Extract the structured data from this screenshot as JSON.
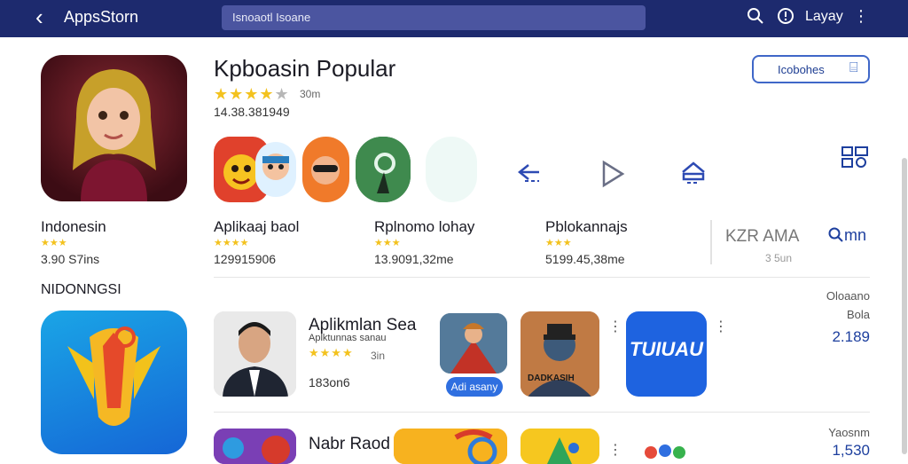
{
  "header": {
    "title": "AppsStorn",
    "search_placeholder": "Isnoaotl Isoane",
    "right_label": "Layay"
  },
  "hero": {
    "title": "Kpboasin Popular",
    "stars": "★★★★",
    "stars_off": "★",
    "rating_text": "30m",
    "downloads": "14.38.381949",
    "install_label": "Icobohes"
  },
  "categories": [
    {
      "name": "Indonesin",
      "stars": "★★★",
      "count": "3.90 S7ins"
    },
    {
      "name": "Aplikaaj baol",
      "stars": "★★★★",
      "count": "129915906"
    },
    {
      "name": "Rplnomo lohay",
      "stars": "★★★",
      "count": "13.9091,32me"
    },
    {
      "name": "Pblokannajs",
      "stars": "★★★",
      "count": "5199.45,38me"
    }
  ],
  "extra": {
    "kzr": "KZR AMA",
    "kzr_sub": "3 5un",
    "more": "mn"
  },
  "section": {
    "title": "NIDONNGSI"
  },
  "featured": {
    "title": "Aplikmlan Sea",
    "subtitle": "Aplktunnas sanau",
    "stars": "★★★★",
    "rating_text": "3in",
    "count": "183on6",
    "pill_label": "Adi asany",
    "tile_label": "TUIUAU",
    "poster_text": "DADKASIH"
  },
  "right_column": [
    {
      "label": "Oloaano",
      "sub": "Bola",
      "value": "2.189"
    },
    {
      "label": "Yaosnm",
      "value": "1,530"
    }
  ],
  "next_row": {
    "title": "Nabr Raod"
  }
}
